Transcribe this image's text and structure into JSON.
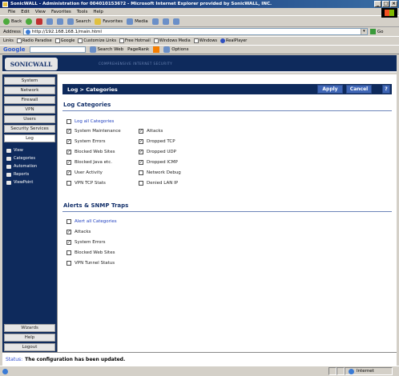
{
  "browser": {
    "title": "SonicWALL - Administration for 0040101536?2 - Microsoft Internet Explorer provided by SonicWALL, INC.",
    "menu": [
      "File",
      "Edit",
      "View",
      "Favorites",
      "Tools",
      "Help"
    ],
    "toolbar": {
      "back": "Back",
      "search": "Search",
      "favorites": "Favorites",
      "media": "Media"
    },
    "address_label": "Address",
    "address_value": "http://192.168.168.1/main.html",
    "go_label": "Go",
    "links_label": "Links",
    "links": [
      "Radio Paradise",
      "Google",
      "Customize Links",
      "Free Hotmail",
      "Windows Media",
      "Windows",
      "RealPlayer"
    ],
    "google": {
      "logo": "Google",
      "search_web": "Search Web",
      "pagerank": "PageRank",
      "options": "Options"
    }
  },
  "header": {
    "logo": "SONICWALL",
    "tagline": "COMPREHENSIVE INTERNET SECURITY"
  },
  "sidebar": {
    "items": [
      "System",
      "Network",
      "Firewall",
      "VPN",
      "Users",
      "Security Services",
      "Log"
    ],
    "active": "Log",
    "subitems": [
      "View",
      "Categories",
      "Automation",
      "Reports",
      "ViewPoint"
    ],
    "bottom": [
      "Wizards",
      "Help",
      "Logout"
    ]
  },
  "panel": {
    "title": "Log > Categories",
    "apply": "Apply",
    "cancel": "Cancel",
    "help": "?"
  },
  "log_categories": {
    "title": "Log Categories",
    "all_label": "Log all Categories",
    "all_checked": false,
    "left": [
      {
        "label": "System Maintenance",
        "checked": true
      },
      {
        "label": "System Errors",
        "checked": true
      },
      {
        "label": "Blocked Web Sites",
        "checked": true
      },
      {
        "label": "Blocked Java etc.",
        "checked": true
      },
      {
        "label": "User Activity",
        "checked": true
      },
      {
        "label": "VPN TCP Stats",
        "checked": false
      }
    ],
    "right": [
      {
        "label": "Attacks",
        "checked": true
      },
      {
        "label": "Dropped TCP",
        "checked": true
      },
      {
        "label": "Dropped UDP",
        "checked": true
      },
      {
        "label": "Dropped ICMP",
        "checked": true
      },
      {
        "label": "Network Debug",
        "checked": false
      },
      {
        "label": "Denied LAN IP",
        "checked": false
      }
    ]
  },
  "alerts": {
    "title": "Alerts & SNMP Traps",
    "all_label": "Alert all Categories",
    "all_checked": false,
    "items": [
      {
        "label": "Attacks",
        "checked": true
      },
      {
        "label": "System Errors",
        "checked": true
      },
      {
        "label": "Blocked Web Sites",
        "checked": false
      },
      {
        "label": "VPN Tunnel Status",
        "checked": false
      }
    ]
  },
  "status": {
    "label": "Status:",
    "message": "The configuration has been updated."
  },
  "statusbar": {
    "zone": "Internet"
  },
  "colors": {
    "navy": "#0e2a5c",
    "button_blue": "#3f66b6",
    "link_blue": "#2040c0"
  }
}
